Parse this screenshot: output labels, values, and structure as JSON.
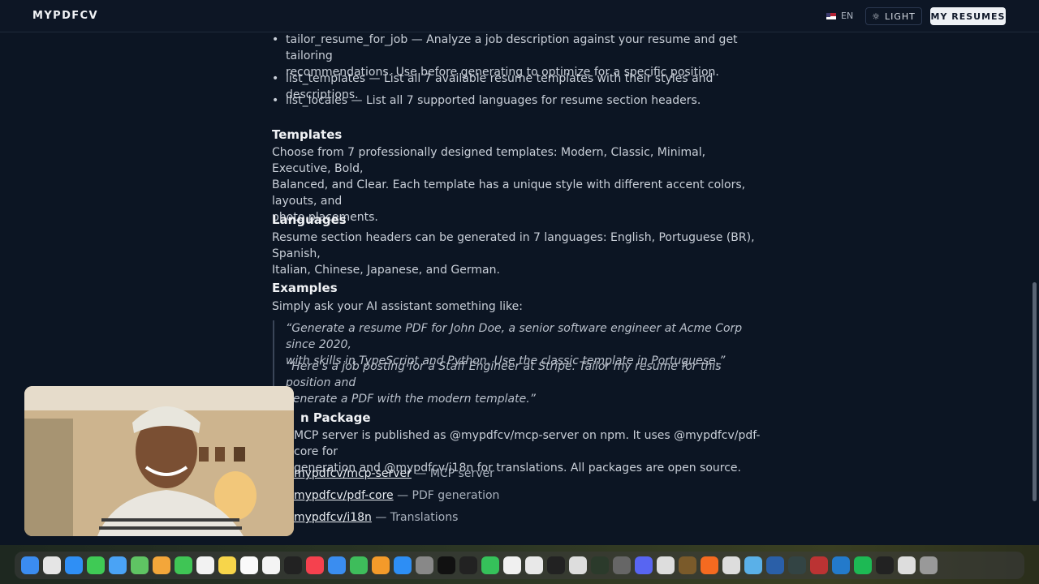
{
  "header": {
    "logo": "MYPDFCV",
    "lang_label": "EN",
    "theme_button": "LIGHT",
    "resumes_button": "MY RESUMES"
  },
  "tools": [
    "tailor_resume_for_job — Analyze a job description against your resume and get tailoring",
    "recommendations. Use before generating to optimize for a specific position.",
    "list_templates — List all 7 available resume templates with their styles and descriptions.",
    "list_locales — List all 7 supported languages for resume section headers."
  ],
  "templates": {
    "heading": "Templates",
    "lines": [
      "Choose from 7 professionally designed templates: Modern, Classic, Minimal, Executive, Bold,",
      "Balanced, and Clear. Each template has a unique style with different accent colors, layouts, and",
      "photo placements."
    ]
  },
  "languages": {
    "heading": "Languages",
    "lines": [
      "Resume section headers can be generated in 7 languages: English, Portuguese (BR), Spanish,",
      "Italian, Chinese, Japanese, and German."
    ]
  },
  "examples": {
    "heading": "Examples",
    "intro": "Simply ask your AI assistant something like:",
    "quote1": [
      "“Generate a resume PDF for John Doe, a senior software engineer at Acme Corp since 2020,",
      "with skills in TypeScript and Python. Use the classic template in Portuguese.”"
    ],
    "quote2": [
      "“Here's a job posting for a Staff Engineer at Stripe. Tailor my resume for this position and",
      "generate a PDF with the modern template.”"
    ]
  },
  "package": {
    "heading": "n Package",
    "lines": [
      "MCP server is published as @mypdfcv/mcp-server on npm. It uses @mypdfcv/pdf-core for",
      "generation and @mypdfcv/i18n for translations. All packages are open source."
    ],
    "links": [
      {
        "name": "mypdfcv/mcp-server",
        "desc": " — MCP server"
      },
      {
        "name": "mypdfcv/pdf-core",
        "desc": " — PDF generation"
      },
      {
        "name": "mypdfcv/i18n",
        "desc": " — Translations"
      }
    ]
  },
  "dock_icons": [
    "finder-icon",
    "launchpad-icon",
    "safari-icon",
    "messages-icon",
    "mail-icon",
    "maps-icon",
    "photos-icon",
    "facetime-icon",
    "calendar-icon",
    "notes-icon",
    "reminders-icon",
    "freeform-icon",
    "tv-icon",
    "music-icon",
    "keynote-icon",
    "numbers-icon",
    "pages-icon",
    "appstore-icon",
    "settings-icon",
    "activity-icon",
    "clock-icon",
    "whatsapp-icon",
    "chrome-icon",
    "slack-icon",
    "terminal-icon",
    "ghost-icon",
    "monitor-icon",
    "calculator-icon",
    "discord-icon",
    "printer-icon",
    "brush-icon",
    "firefox-icon",
    "preview-icon",
    "grid-icon",
    "globe-icon",
    "screen-icon",
    "dictionary-icon",
    "vscode-icon",
    "spotify-icon",
    "piano-icon",
    "file-icon",
    "trash-icon"
  ],
  "colors": {
    "background": "#0c1523",
    "accent": "#eef1f5"
  }
}
